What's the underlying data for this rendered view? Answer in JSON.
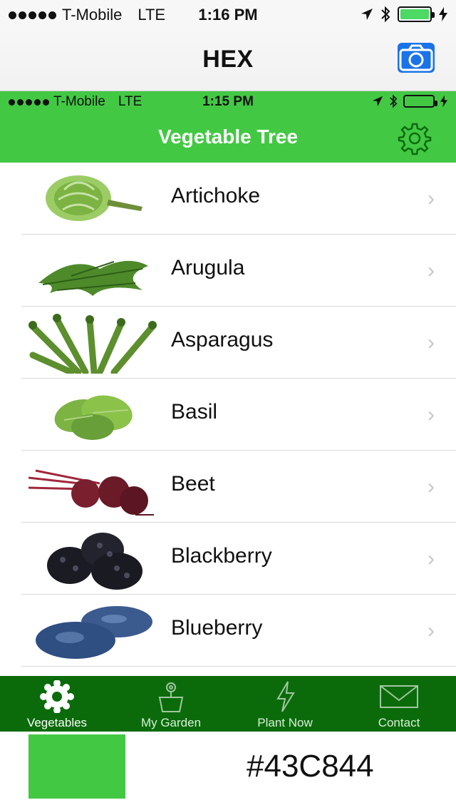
{
  "outer_status": {
    "carrier": "T-Mobile",
    "network": "LTE",
    "time": "1:16 PM"
  },
  "outer_nav": {
    "title": "HEX",
    "camera_icon": "camera-icon"
  },
  "inner_status": {
    "carrier": "T-Mobile",
    "network": "LTE",
    "time": "1:15 PM"
  },
  "inner_nav": {
    "title": "Vegetable Tree",
    "settings_icon": "gear-icon"
  },
  "list": {
    "items": [
      {
        "label": "Artichoke",
        "thumb": "artichoke"
      },
      {
        "label": "Arugula",
        "thumb": "arugula"
      },
      {
        "label": "Asparagus",
        "thumb": "asparagus"
      },
      {
        "label": "Basil",
        "thumb": "basil"
      },
      {
        "label": "Beet",
        "thumb": "beet"
      },
      {
        "label": "Blackberry",
        "thumb": "blackberry"
      },
      {
        "label": "Blueberry",
        "thumb": "blueberry"
      }
    ]
  },
  "tabbar": {
    "tabs": [
      {
        "label": "Vegetables",
        "icon": "flower-gear-icon",
        "active": true
      },
      {
        "label": "My Garden",
        "icon": "flower-pot-icon"
      },
      {
        "label": "Plant Now",
        "icon": "lightning-icon"
      },
      {
        "label": "Contact",
        "icon": "envelope-icon"
      }
    ]
  },
  "color_result": {
    "hex": "#43C844",
    "swatch_color": "#43C844"
  },
  "colors": {
    "brand_green": "#43C844",
    "tab_green": "#0B6B0B",
    "ios_blue": "#1A73E8"
  }
}
